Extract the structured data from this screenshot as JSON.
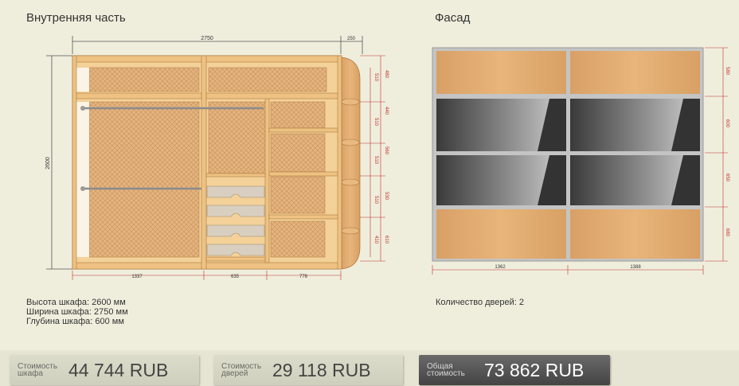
{
  "inner": {
    "title": "Внутренняя часть",
    "dim_width": "2750",
    "dim_depth": "250",
    "dim_height": "2600",
    "bottom_dims": [
      "1337",
      "635",
      "778"
    ],
    "right_inner": [
      "510",
      "510",
      "510",
      "510",
      "410"
    ],
    "right_outer": [
      "480",
      "440",
      "560",
      "530",
      "610"
    ],
    "info": [
      "Высота шкафа: 2600 мм",
      "Ширина шкафа: 2750 мм",
      "Глубина шкафа: 600 мм"
    ]
  },
  "facade": {
    "title": "Фасад",
    "bottom_dims": [
      "1362",
      "1388"
    ],
    "right_dims": [
      "580",
      "600",
      "650",
      "680"
    ],
    "doors_count": "Количество дверей: 2"
  },
  "prices": [
    {
      "label": "Стоимость\nшкафа",
      "value": "44 744  RUB"
    },
    {
      "label": "Стоимость\nдверей",
      "value": "29 118  RUB"
    },
    {
      "label": "Общая\nстоимость",
      "value": "73 862  RUB"
    }
  ],
  "colors": {
    "wood": "#e8b57a",
    "panel": "#f4cf97",
    "mesh": "#e2b27c",
    "glass": "#4a4a4a",
    "frame": "#c9c9c9",
    "dim_line": "#c0302a"
  }
}
